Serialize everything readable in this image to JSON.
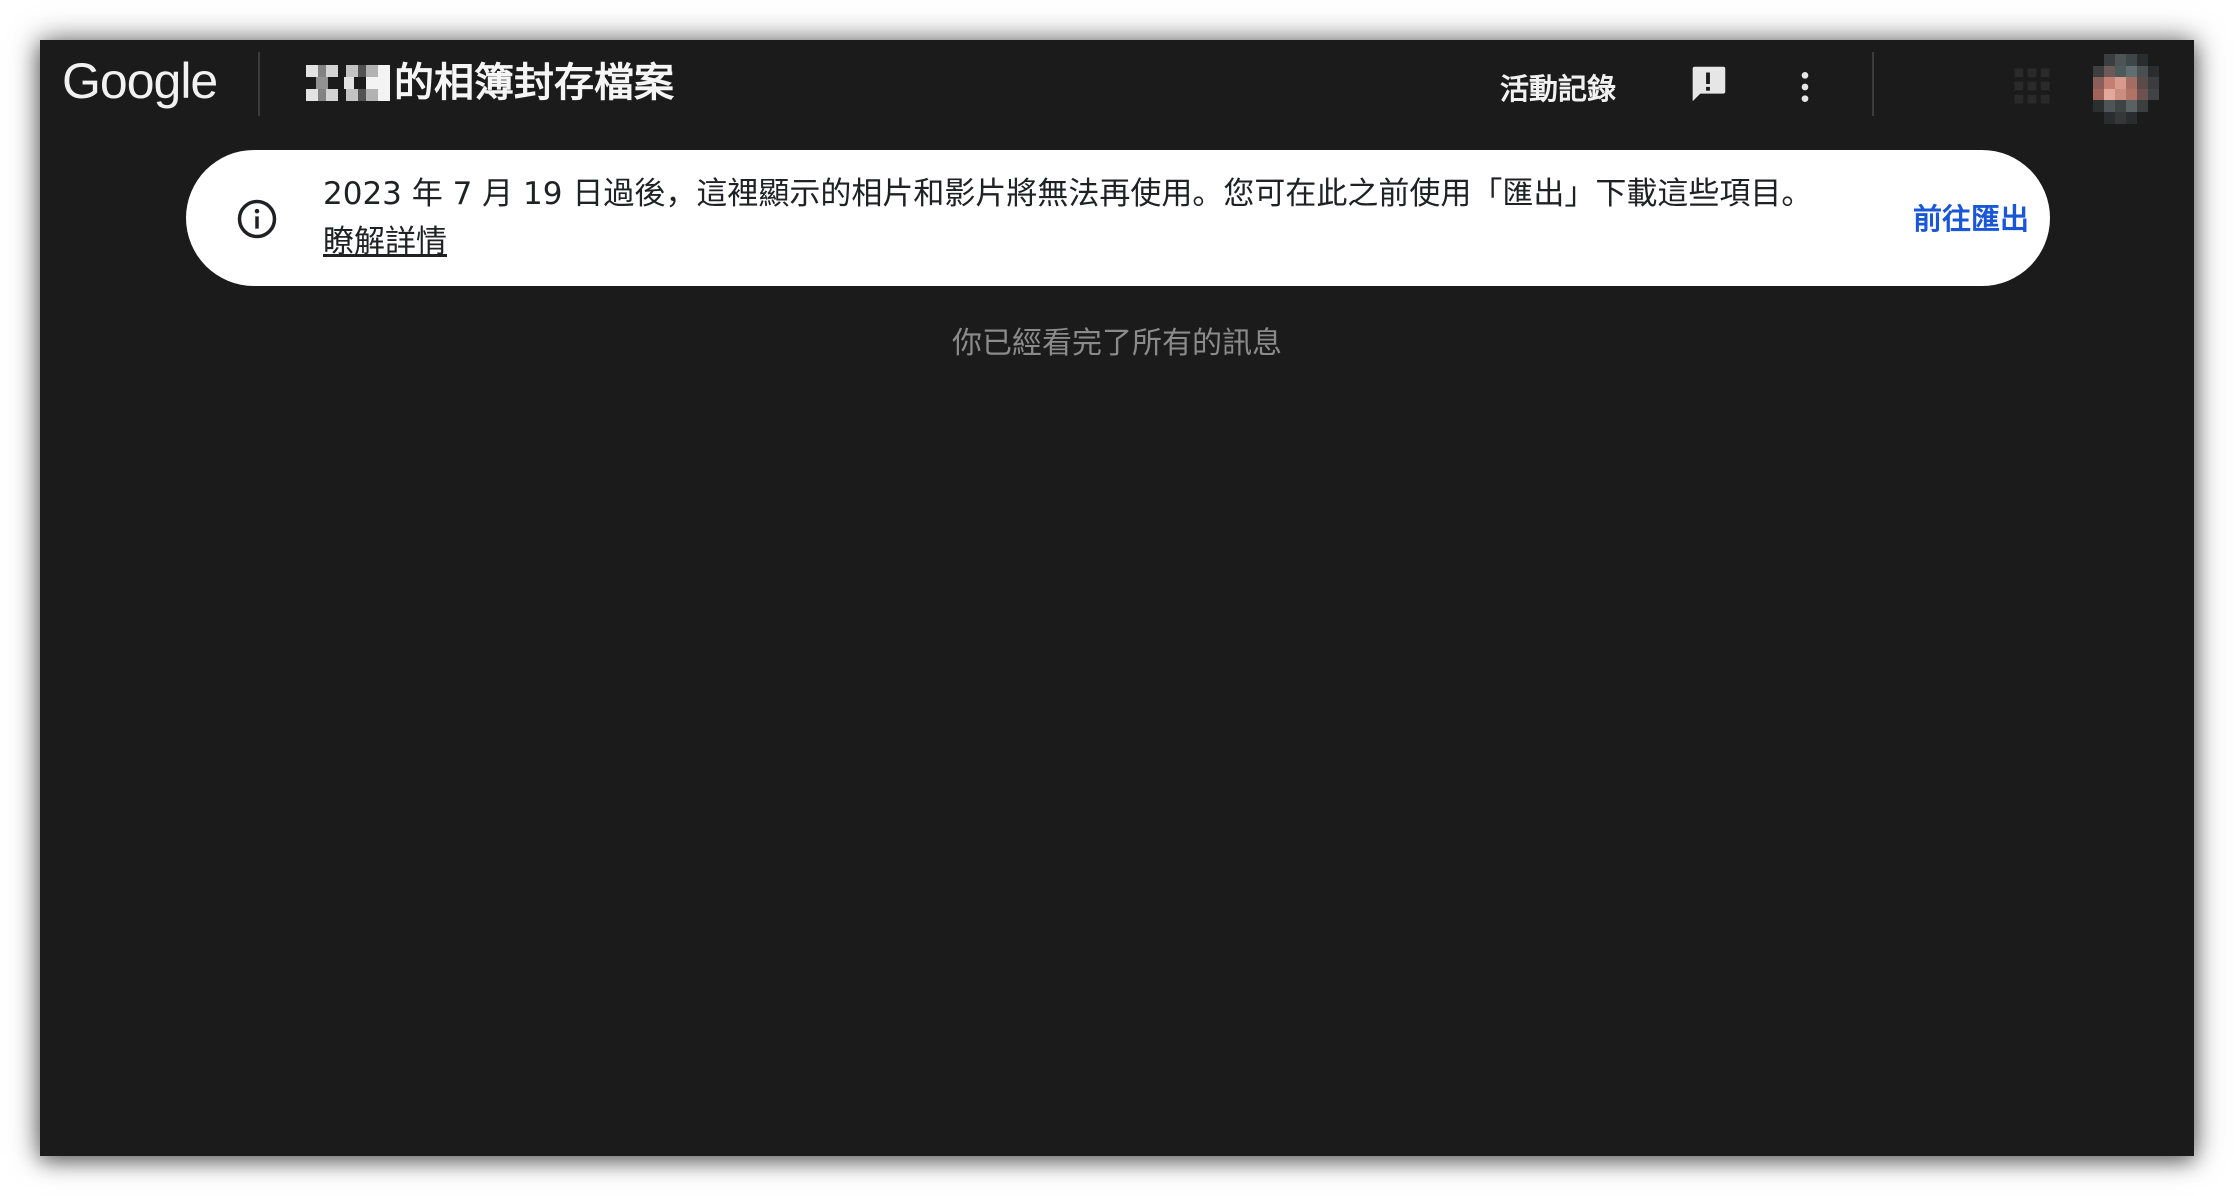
{
  "header": {
    "logo_text": "Google",
    "title_suffix": "的相簿封存檔案",
    "activity_label": "活動記錄",
    "icons": [
      "feedback-icon",
      "more-vert-icon",
      "apps-grid-icon",
      "avatar"
    ]
  },
  "banner": {
    "message": "2023 年 7 月 19 日過後，這裡顯示的相片和影片將無法再使用。您可在此之前使用「匯出」下載這些項目。",
    "learn_more": "瞭解詳情",
    "action_label": "前往匯出",
    "icon": "info-icon"
  },
  "main": {
    "empty_message": "你已經看完了所有的訊息"
  },
  "colors": {
    "background": "#1b1b1b",
    "banner_bg": "#ffffff",
    "link_blue": "#1a57d6",
    "muted_text": "#8b8b8b"
  }
}
